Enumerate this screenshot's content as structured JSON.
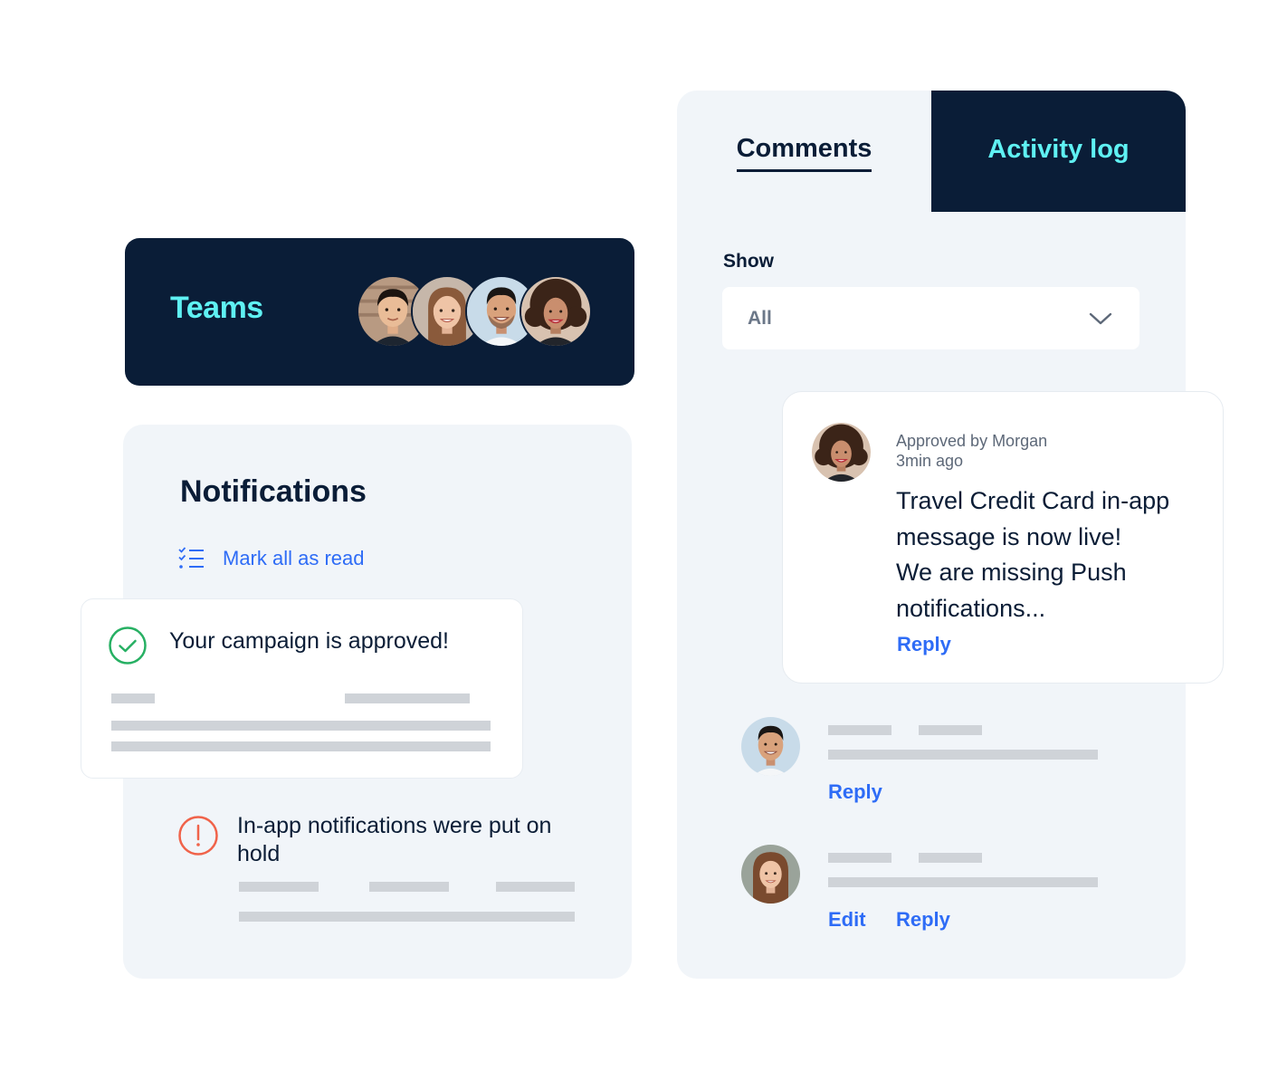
{
  "teams": {
    "title": "Teams",
    "members": [
      {
        "name": "member-1",
        "skin": "#e9bc97",
        "hair": "#1b1410",
        "bg": "#b89a82",
        "shirt": "#1d2530"
      },
      {
        "name": "member-2",
        "skin": "#efc4a6",
        "hair": "#8a5a3b",
        "bg": "#c6b7aa",
        "shirt": "#8a5a3b"
      },
      {
        "name": "member-3",
        "skin": "#d9a27c",
        "hair": "#1a1614",
        "bg": "#c8dbe9",
        "shirt": "#f4f6f8"
      },
      {
        "name": "member-4",
        "skin": "#c98e6e",
        "hair": "#3b2418",
        "bg": "#d8c2b0",
        "shirt": "#22252b"
      }
    ]
  },
  "notifications": {
    "title": "Notifications",
    "mark_all_label": "Mark all as read",
    "items": [
      {
        "type": "success",
        "icon": "check-circle-icon",
        "message": "Your campaign is approved!",
        "color": "#27b063"
      },
      {
        "type": "warning",
        "icon": "alert-circle-icon",
        "message": "In-app notifications were put on hold",
        "color": "#f0634a"
      }
    ]
  },
  "comments_panel": {
    "tabs": [
      {
        "label": "Comments",
        "active": true
      },
      {
        "label": "Activity log",
        "active": false
      }
    ],
    "filter": {
      "label": "Show",
      "value": "All"
    },
    "featured_comment": {
      "author_line": "Approved by Morgan",
      "time": "3min ago",
      "body": "Travel Credit Card in-app message is now live! We are missing Push notifications...",
      "body_lines": [
        "Travel Credit Card in-app",
        "message is now live!",
        "We are missing Push",
        "notifications..."
      ],
      "reply_label": "Reply"
    },
    "comments": [
      {
        "actions": [
          "Reply"
        ]
      },
      {
        "actions": [
          "Edit",
          "Reply"
        ]
      }
    ]
  },
  "colors": {
    "navy": "#0a1d37",
    "cyan": "#5ff1f3",
    "link_blue": "#2e6cf6",
    "panel_bg": "#f1f5f9",
    "skeleton": "#cfd3d8"
  }
}
